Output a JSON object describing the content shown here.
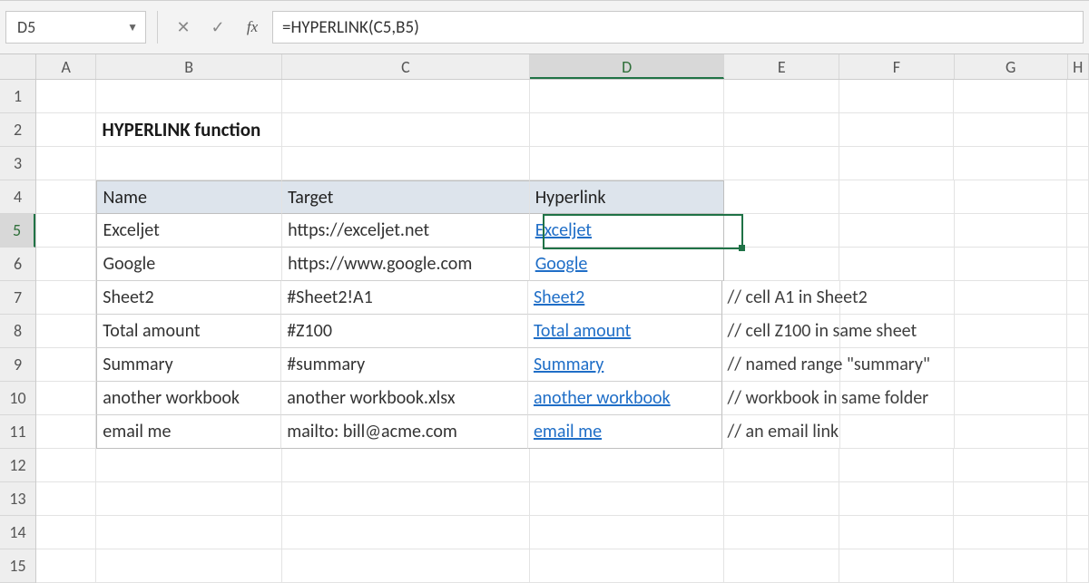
{
  "formula_bar": {
    "name_box": "D5",
    "fx_label": "fx",
    "formula": "=HYPERLINK(C5,B5)"
  },
  "columns": [
    "A",
    "B",
    "C",
    "D",
    "E",
    "F",
    "G",
    "H"
  ],
  "row_count": 15,
  "selected": {
    "col": "D",
    "row": 5
  },
  "title": "HYPERLINK function",
  "headers": {
    "name": "Name",
    "target": "Target",
    "link": "Hyperlink"
  },
  "rows": [
    {
      "name": "Exceljet",
      "target": "https://exceljet.net",
      "link": "Exceljet",
      "comment": ""
    },
    {
      "name": "Google",
      "target": "https://www.google.com",
      "link": "Google",
      "comment": ""
    },
    {
      "name": "Sheet2",
      "target": "#Sheet2!A1",
      "link": "Sheet2",
      "comment": "// cell A1 in  Sheet2"
    },
    {
      "name": "Total amount",
      "target": "#Z100",
      "link": "Total amount",
      "comment": "// cell Z100 in same sheet"
    },
    {
      "name": "Summary",
      "target": "#summary",
      "link": "Summary",
      "comment": "// named range \"summary\""
    },
    {
      "name": "another workbook",
      "target": "another workbook.xlsx",
      "link": "another workbook",
      "comment": "// workbook in same folder"
    },
    {
      "name": "email me",
      "target": "mailto: bill@acme.com",
      "link": "email me",
      "comment": "// an email link"
    }
  ]
}
